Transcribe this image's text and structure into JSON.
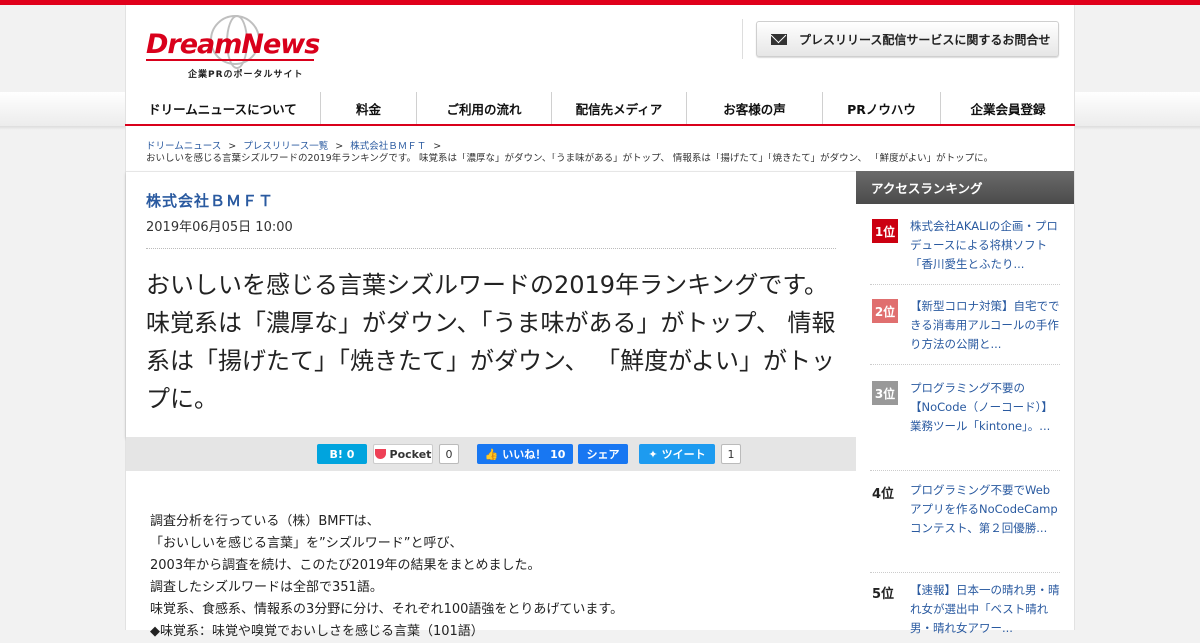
{
  "header": {
    "logo_text": "DreamNews",
    "logo_sub": "企業PRのポータルサイト",
    "contact_label": "プレスリリース配信サービスに関するお問合せ"
  },
  "nav": [
    {
      "label": "ドリームニュースについて"
    },
    {
      "label": "料金"
    },
    {
      "label": "ご利用の流れ"
    },
    {
      "label": "配信先メディア"
    },
    {
      "label": "お客様の声"
    },
    {
      "label": "PRノウハウ"
    },
    {
      "label": "企業会員登録"
    }
  ],
  "breadcrumb": {
    "items": [
      "ドリームニュース",
      "プレスリリース一覧",
      "株式会社ＢＭＦＴ"
    ],
    "separator": ">",
    "current": "おいしいを感じる言葉シズルワードの2019年ランキングです。 味覚系は「濃厚な」がダウン、「うま味がある」がトップ、 情報系は「揚げたて」「焼きたて」がダウン、 「鮮度がよい」がトップに。"
  },
  "article": {
    "company": "株式会社ＢＭＦＴ",
    "date": "2019年06月05日 10:00",
    "headline": "おいしいを感じる言葉シズルワードの2019年ランキングです。 味覚系は「濃厚な」がダウン、「うま味がある」がトップ、 情報系は「揚げたて」「焼きたて」がダウン、 「鮮度がよい」がトップに。",
    "body": [
      "調査分析を行っている（株）BMFTは、",
      "「おいしいを感じる言葉」を”シズルワード”と呼び、",
      "2003年から調査を続け、このたび2019年の結果をまとめました。",
      "調査したシズルワードは全部で351語。",
      "味覚系、食感系、情報系の3分野に分け、それぞれ100語強をとりあげています。",
      "◆味覚系：味覚や嗅覚でおいしさを感じる言葉（101語）"
    ]
  },
  "share": {
    "hatena_label": "B! 0",
    "pocket_label": "Pocket",
    "pocket_count": "0",
    "like_label": "いいね！ 10",
    "share_label": "シェア",
    "tweet_label": "ツイート",
    "tweet_count": "1"
  },
  "sidebar": {
    "title": "アクセスランキング",
    "ranks": [
      {
        "badge": "1位",
        "text": "株式会社AKALIの企画・プロデュースによる将棋ソフト「香川愛生とふたり...",
        "color": "#cc0011"
      },
      {
        "badge": "2位",
        "text": "【新型コロナ対策】自宅でできる消毒用アルコールの手作り方法の公開と...",
        "color": "#e06f6f"
      },
      {
        "badge": "3位",
        "text": "プログラミング不要の【NoCode（ノーコード）】業務ツール「kintone」。...",
        "color": "#999999"
      },
      {
        "badge": "4位",
        "text": "プログラミング不要でWebアプリを作るNoCodeCampコンテスト、第２回優勝..."
      },
      {
        "badge": "5位",
        "text": "【速報】日本一の晴れ男・晴れ女が選出中「ベスト晴れ男・晴れ女アワー..."
      }
    ]
  },
  "colors": {
    "brand_red": "#d9001b",
    "link_blue": "#2a5aa0"
  }
}
